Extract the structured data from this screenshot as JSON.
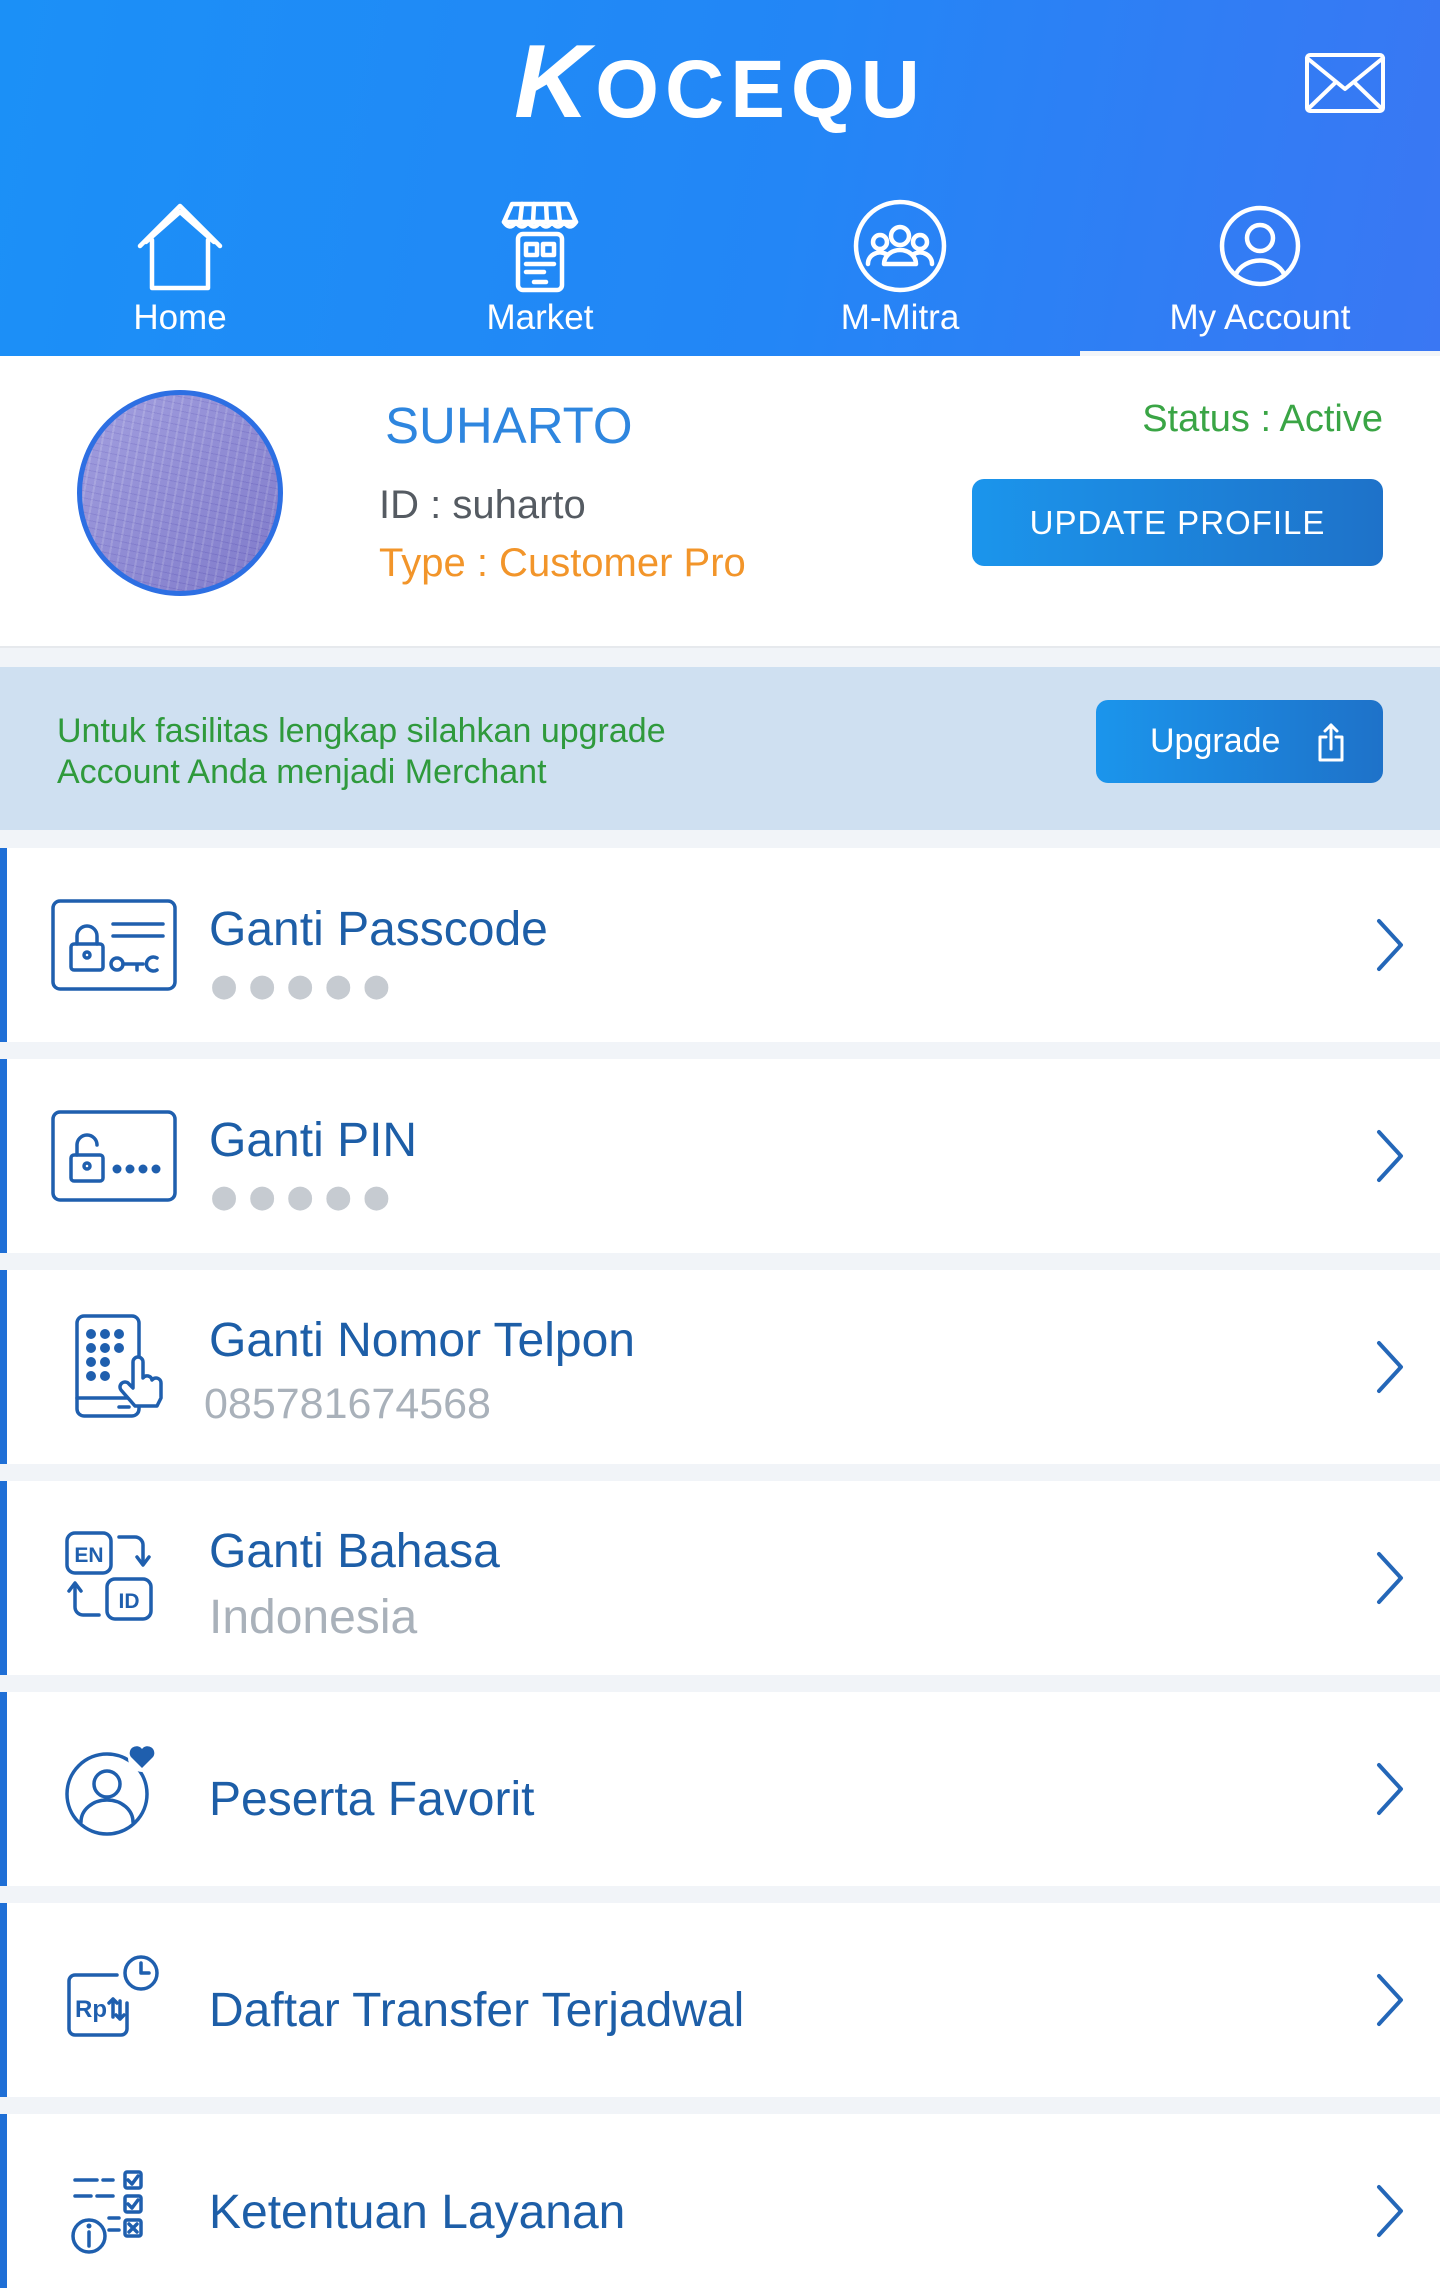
{
  "header": {
    "logo_text": "KOCEQU",
    "mail_icon": "mail-icon"
  },
  "nav": {
    "tabs": [
      {
        "label": "Home",
        "icon": "home-icon",
        "active": false
      },
      {
        "label": "Market",
        "icon": "market-icon",
        "active": false
      },
      {
        "label": "M-Mitra",
        "icon": "group-icon",
        "active": false
      },
      {
        "label": "My Account",
        "icon": "account-icon",
        "active": true
      }
    ]
  },
  "profile": {
    "name": "SUHARTO",
    "id_text": "ID : suharto",
    "type_text": "Type : Customer Pro",
    "status_text": "Status : Active",
    "update_button": "UPDATE PROFILE"
  },
  "upgrade_banner": {
    "line1": "Untuk fasilitas lengkap silahkan upgrade",
    "line2": "Account Anda menjadi Merchant",
    "button": "Upgrade",
    "button_icon": "share-icon"
  },
  "menu": [
    {
      "title": "Ganti Passcode",
      "masked_value": "●●●●●",
      "icon": "passcode-icon"
    },
    {
      "title": "Ganti PIN",
      "masked_value": "●●●●●",
      "icon": "pin-icon"
    },
    {
      "title": "Ganti Nomor Telpon",
      "value": "085781674568",
      "icon": "phone-keypad-icon"
    },
    {
      "title": "Ganti Bahasa",
      "value": "Indonesia",
      "icon": "language-icon",
      "icon_labels": [
        "EN",
        "ID"
      ]
    },
    {
      "title": "Peserta Favorit",
      "icon": "favorite-user-icon"
    },
    {
      "title": "Daftar Transfer Terjadwal",
      "icon": "scheduled-transfer-icon",
      "icon_label": "Rp"
    },
    {
      "title": "Ketentuan Layanan",
      "icon": "terms-icon"
    }
  ],
  "colors": {
    "header_gradient": [
      "#1b90f7",
      "#3a77f3"
    ],
    "button_gradient": [
      "#1b95ec",
      "#1e72c9"
    ],
    "accent": "#1f6fd6",
    "name_blue": "#2e86df",
    "menu_title": "#1d5ea7",
    "status_green": "#3aa545",
    "type_orange": "#f2952a",
    "banner_bg": "#cfe0f1",
    "banner_text": "#2f9a3c"
  }
}
